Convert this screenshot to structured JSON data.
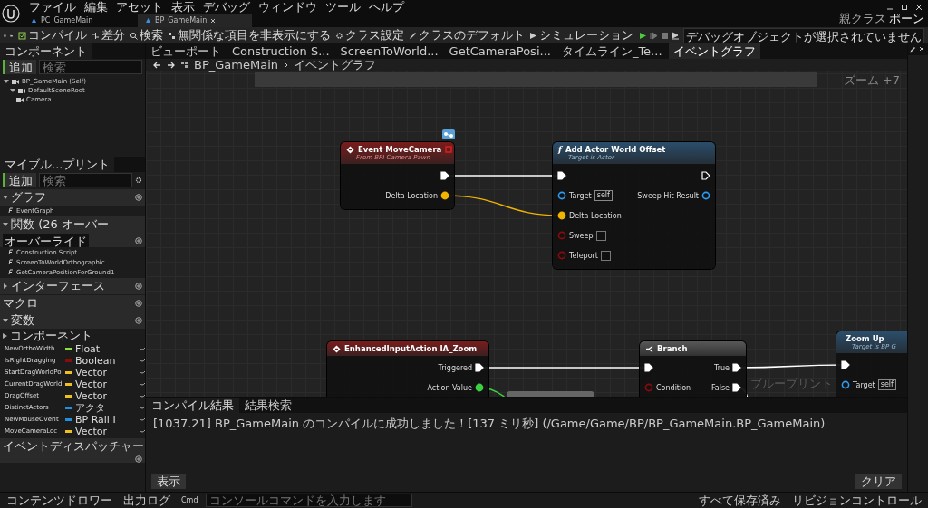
{
  "window": {
    "menu": [
      "ファイル",
      "編集",
      "アセット",
      "表示",
      "デバッグ",
      "ウィンドウ",
      "ツール",
      "ヘルプ"
    ],
    "tabs": [
      {
        "label": "PC_GameMain",
        "selected": false
      },
      {
        "label": "BP_GameMain",
        "selected": true
      }
    ],
    "parent_class_label": "親クラス",
    "parent_class": "ポーン"
  },
  "toolbar": {
    "buttons": [
      {
        "kind": "compile",
        "label": "コンパイル"
      },
      {
        "kind": "diff",
        "label": "差分"
      },
      {
        "kind": "find",
        "label": "検索"
      },
      {
        "kind": "hide",
        "label": "無関係な項目を非表示にする"
      },
      {
        "kind": "settings",
        "label": "クラス設定"
      },
      {
        "kind": "defaults",
        "label": "クラスのデフォルト"
      },
      {
        "kind": "simulate",
        "label": "シミュレーション"
      }
    ],
    "debug_object": "デバッグオブジェクトが選択されていません"
  },
  "components": {
    "tab": "コンポーネント",
    "add": "追加",
    "search_placeholder": "検索",
    "tree": [
      {
        "label": "BP_GameMain (Self)",
        "children": [
          {
            "label": "DefaultSceneRoot",
            "children": [
              {
                "label": "Camera"
              }
            ]
          }
        ]
      }
    ]
  },
  "my_blueprint": {
    "tab": "マイブル...プリント",
    "add": "追加",
    "search_placeholder": "検索",
    "sections": [
      {
        "title": "グラフ",
        "expanded": true,
        "items": [
          "EventGraph"
        ]
      },
      {
        "title": "関数 (26 オーバー",
        "dropdown": "オーバーライド",
        "expanded": true,
        "items": [
          "Construction Script",
          "ScreenToWorldOrthographic",
          "GetCameraPositionForGround1"
        ]
      },
      {
        "title": "インターフェース",
        "expanded": false
      },
      {
        "title": "マクロ"
      },
      {
        "title": "変数",
        "expanded": true,
        "subsection": "コンポーネント",
        "variables": [
          {
            "name": "NewOrthoWidth",
            "type": "Float",
            "color": "#8ee03c"
          },
          {
            "name": "IsRightDragging",
            "type": "Boolean",
            "color": "#8c0a0a"
          },
          {
            "name": "StartDragWorldPo",
            "type": "Vector",
            "color": "#f0c020"
          },
          {
            "name": "CurrentDragWorld",
            "type": "Vector",
            "color": "#f0c020"
          },
          {
            "name": "DragOffset",
            "type": "Vector",
            "color": "#f0c020"
          },
          {
            "name": "DistinctActors",
            "type": "アクタ",
            "color": "#1f8fe0"
          },
          {
            "name": "NewMouseOverIt",
            "type": "BP Rail I",
            "color": "#1f8fe0"
          },
          {
            "name": "MoveCameraLoc",
            "type": "Vector",
            "color": "#f0c020"
          }
        ]
      },
      {
        "title": "イベントディスパッチャー"
      }
    ]
  },
  "graph": {
    "tabs": [
      {
        "label": "ビューポート",
        "selected": false
      },
      {
        "label": "Construction S...",
        "selected": false
      },
      {
        "label": "ScreenToWorld...",
        "selected": false
      },
      {
        "label": "GetCameraPosi...",
        "selected": false
      },
      {
        "label": "タイムライン_Te...",
        "selected": false
      },
      {
        "label": "イベントグラフ",
        "selected": true
      }
    ],
    "breadcrumb": [
      "BP_GameMain",
      "イベントグラフ"
    ],
    "zoom": "ズーム +7",
    "watermark": "ブループリント",
    "nodes": [
      {
        "kind": "event",
        "title": "Event MoveCamera",
        "subtitle": "From BPI Camera Pawn",
        "replicated": true,
        "delegate_pin": true,
        "rows": [
          {
            "right": {
              "kind": "exec",
              "connected": true
            }
          },
          {
            "right": {
              "kind": "data",
              "label": "Delta Location",
              "color": "#f0b400",
              "connected": true
            }
          }
        ]
      },
      {
        "kind": "function",
        "glyph": "f",
        "title": "Add Actor World Offset",
        "subtitle": "Target is Actor",
        "rows": [
          {
            "left": {
              "kind": "exec",
              "connected": true
            },
            "right": {
              "kind": "exec",
              "connected": false
            }
          },
          {
            "left": {
              "kind": "data",
              "label": "Target",
              "color": "#2a9df4",
              "connected": false,
              "value": "self"
            },
            "right": {
              "kind": "data",
              "label": "Sweep Hit Result",
              "color": "#2a9df4",
              "connected": false
            }
          },
          {
            "left": {
              "kind": "data",
              "label": "Delta Location",
              "color": "#f0b400",
              "connected": true
            }
          },
          {
            "left": {
              "kind": "data",
              "label": "Sweep",
              "color": "#8c0a0a",
              "connected": false,
              "checked": false
            }
          },
          {
            "left": {
              "kind": "data",
              "label": "Teleport",
              "color": "#8c0a0a",
              "connected": false,
              "checked": false
            }
          }
        ]
      },
      {
        "kind": "event",
        "title": "EnhancedInputAction IA_Zoom",
        "rows": [
          {
            "right": {
              "kind": "exec",
              "label": "Triggered",
              "connected": true
            }
          },
          {
            "right": {
              "kind": "data",
              "label": "Action Value",
              "color": "#3cd040",
              "connected": true
            }
          }
        ]
      },
      {
        "kind": "macro",
        "title": "Branch",
        "rows": [
          {
            "left": {
              "kind": "exec",
              "connected": true
            },
            "right": {
              "kind": "exec",
              "label": "True",
              "connected": true
            }
          },
          {
            "left": {
              "kind": "data",
              "label": "Condition",
              "color": "#8c0a0a",
              "connected": false
            },
            "right": {
              "kind": "exec",
              "label": "False",
              "connected": true
            }
          }
        ]
      },
      {
        "kind": "function",
        "title": "Zoom Up",
        "subtitle": "Target is BP G",
        "rows": [
          {
            "left": {
              "kind": "exec",
              "connected": true
            }
          },
          {
            "left": {
              "kind": "data",
              "label": "Target",
              "color": "#2a9df4",
              "connected": false,
              "value": "self"
            }
          }
        ]
      }
    ]
  },
  "output": {
    "tabs": [
      {
        "label": "コンパイル結果",
        "selected": true
      },
      {
        "label": "結果検索",
        "selected": false
      }
    ],
    "messages": [
      "[1037.21] BP_GameMain のコンパイルに成功しました！[137 ミリ秒] (/Game/Game/BP/BP_GameMain.BP_GameMain)"
    ],
    "filter": "表示",
    "clear": "クリア"
  },
  "status_bar": {
    "content_drawer": "コンテンツドロワー",
    "output_log": "出力ログ",
    "cmd": "Cmd",
    "console_placeholder": "コンソールコマンドを入力します",
    "saved": "すべて保存済み",
    "revision_control": "リビジョンコントロール"
  }
}
